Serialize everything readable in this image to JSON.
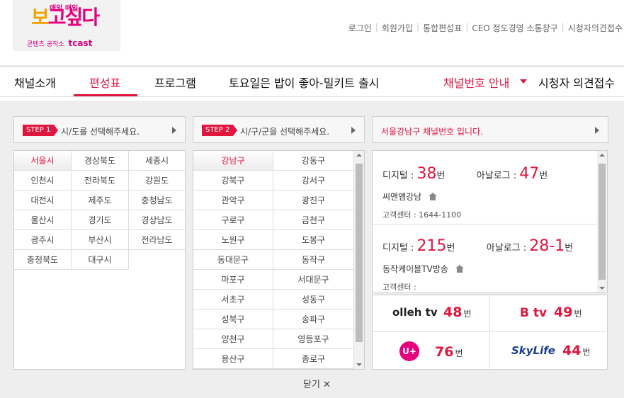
{
  "logo": {
    "top": "매일 매일",
    "main_a": "보",
    "main_b": "고싶다",
    "sub": "콘텐츠 공작소",
    "brand": "tcast"
  },
  "util": [
    "로그인",
    "회원가입",
    "통합편성표",
    "CEO 정도경영 소통창구",
    "시청자의견접수"
  ],
  "gnb": {
    "items": [
      "채널소개",
      "편성표",
      "프로그램",
      "토요일은 밥이 좋아-밀키트 출시"
    ],
    "channel_info": "채널번호 안내",
    "feedback": "시청자 의견접수"
  },
  "step1": {
    "badge": "STEP 1",
    "text": "시/도를 선택해주세요."
  },
  "step2": {
    "badge": "STEP 2",
    "text": "시/구/군을 선택해주세요."
  },
  "info_header": "서울강남구 채널번호 입니다.",
  "regions": [
    "서울시",
    "경상북도",
    "세종시",
    "인천시",
    "전라북도",
    "강원도",
    "대전시",
    "제주도",
    "충청남도",
    "울산시",
    "경기도",
    "경상남도",
    "광주시",
    "부산시",
    "전라남도",
    "충청북도",
    "대구시"
  ],
  "districts": [
    "강남구",
    "강동구",
    "강북구",
    "강서구",
    "관악구",
    "광진구",
    "구로구",
    "금천구",
    "노원구",
    "도봉구",
    "동대문구",
    "동작구",
    "마포구",
    "서대문구",
    "서초구",
    "성동구",
    "성북구",
    "송파구",
    "양천구",
    "영등포구",
    "용산구",
    "종로구"
  ],
  "operators": [
    {
      "digital_label": "디지털 :",
      "digital_num": "38",
      "analog_label": "아날로그 :",
      "analog_num": "47",
      "unit": "번",
      "name": "씨앤앰강남",
      "cc": "고객센터 : 1644-1100"
    },
    {
      "digital_label": "디지털 :",
      "digital_num": "215",
      "analog_label": "아날로그 :",
      "analog_num": "28-1",
      "unit": "번",
      "name": "동작케이블TV방송",
      "cc": "고객센터 :"
    }
  ],
  "iptv": [
    {
      "brand": "olleh tv",
      "num": "48",
      "unit": "번",
      "color": "#222222"
    },
    {
      "brand": "B tv",
      "num": "49",
      "unit": "번",
      "color": "#e0163e"
    },
    {
      "brand": "U+",
      "num": "76",
      "unit": "번",
      "color": "#e6007e"
    },
    {
      "brand": "SkyLife",
      "num": "44",
      "unit": "번",
      "color": "#1a3d8f"
    }
  ],
  "close_label": "닫기 ✕",
  "colors": {
    "accent": "#e0163e",
    "panel_bg": "#eeeeee"
  }
}
